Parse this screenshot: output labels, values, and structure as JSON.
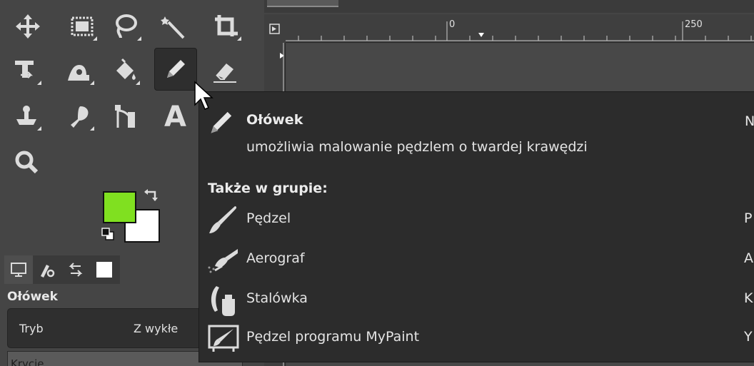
{
  "toolbox": {
    "tools": [
      {
        "icon": "move-icon"
      },
      {
        "icon": "rect-select-icon"
      },
      {
        "icon": "free-select-icon"
      },
      {
        "icon": "fuzzy-select-icon"
      },
      {
        "icon": "crop-icon"
      },
      {
        "icon": "transform-icon"
      },
      {
        "icon": "warp-icon"
      },
      {
        "icon": "bucket-fill-icon"
      },
      {
        "icon": "pencil-icon"
      },
      {
        "icon": "eraser-icon"
      },
      {
        "icon": "clone-icon"
      },
      {
        "icon": "smudge-icon"
      },
      {
        "icon": "paths-icon"
      },
      {
        "icon": "text-icon"
      },
      {
        "icon": "zoom-icon"
      }
    ],
    "active_tool": "pencil-icon",
    "fg_color": "#80e020",
    "bg_color": "#ffffff"
  },
  "tool_options": {
    "title": "Ołówek",
    "mode_label": "Tryb",
    "mode_value": "Z wykłe",
    "opacity_label": "Krycie"
  },
  "ruler": {
    "marks": [
      "0",
      "250"
    ]
  },
  "tooltip": {
    "title": "Ołówek",
    "shortcut": "N",
    "description": "umożliwia malowanie pędzlem o twardej krawędzi",
    "group_header": "Także w grupie:",
    "items": [
      {
        "label": "Pędzel",
        "shortcut": "P",
        "icon": "paintbrush-icon"
      },
      {
        "label": "Aerograf",
        "shortcut": "A",
        "icon": "airbrush-icon"
      },
      {
        "label": "Stalówka",
        "shortcut": "K",
        "icon": "ink-icon"
      },
      {
        "label": "Pędzel programu MyPaint",
        "shortcut": "Y",
        "icon": "mypaint-brush-icon"
      }
    ]
  }
}
